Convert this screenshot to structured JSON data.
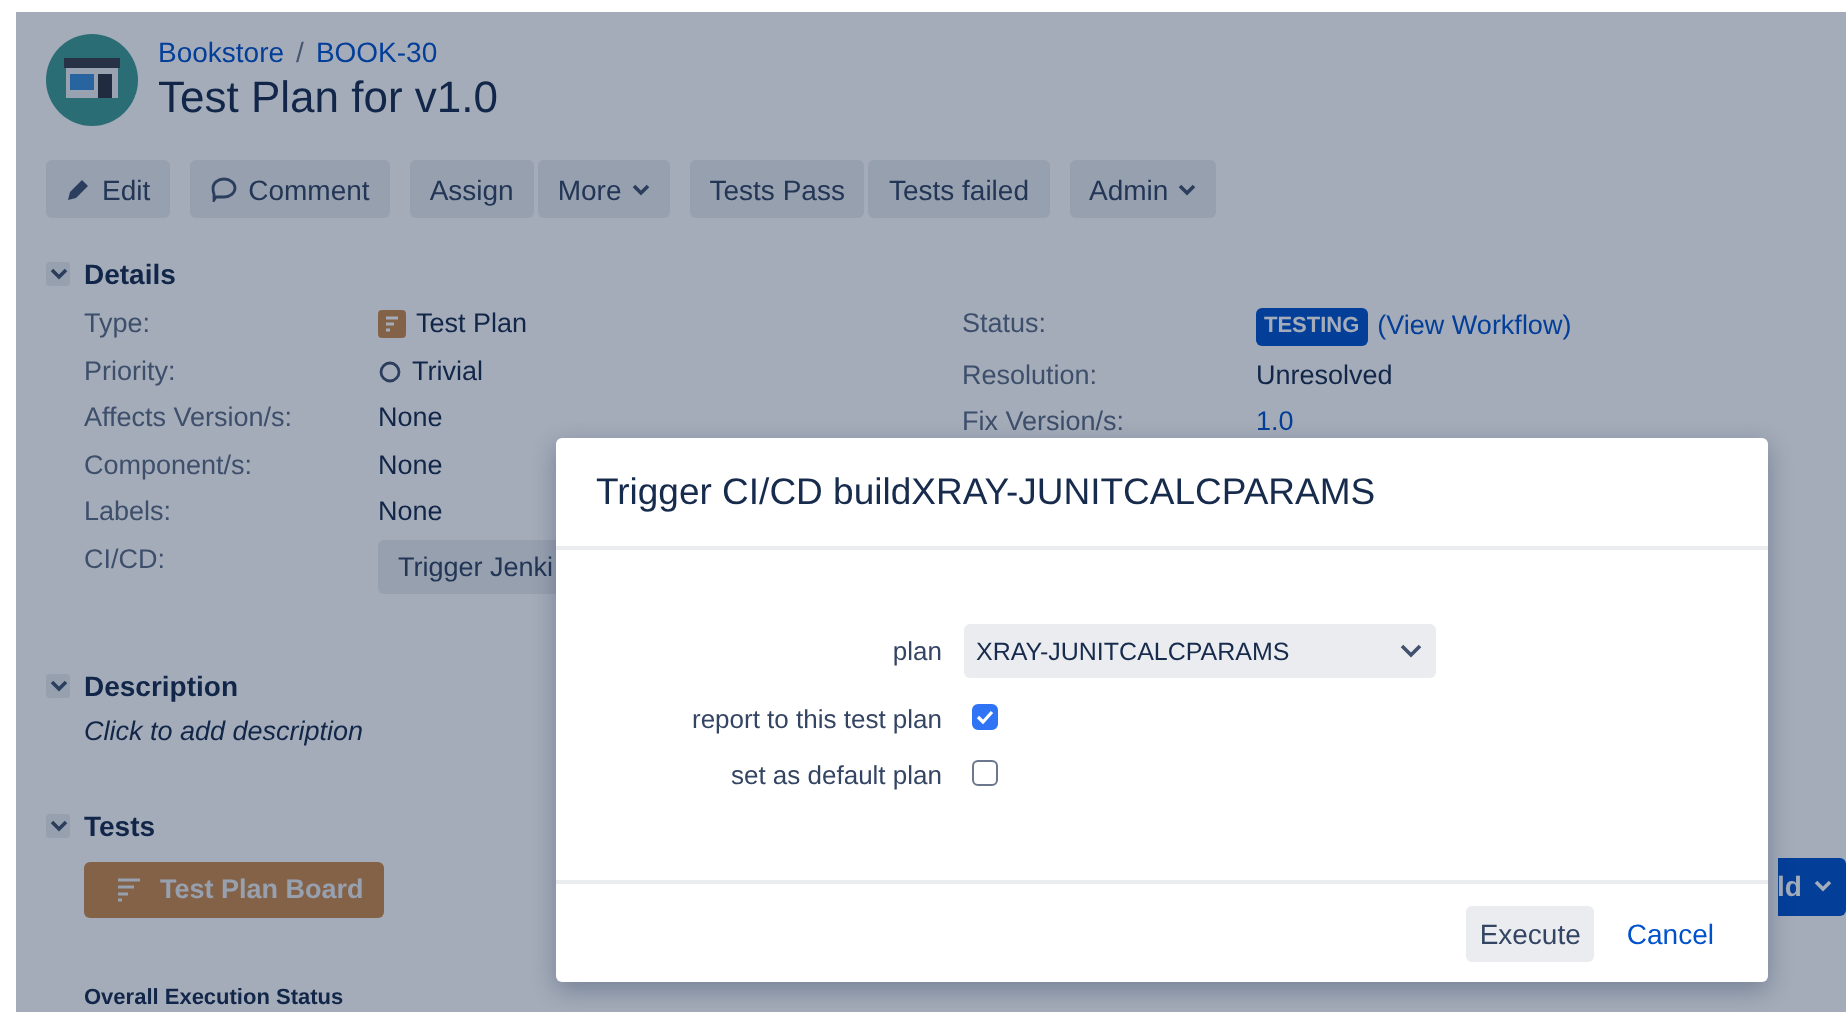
{
  "header": {
    "breadcrumbs": [
      "Bookstore",
      "BOOK-30"
    ],
    "separator": "/",
    "title": "Test Plan for v1.0"
  },
  "toolbar_groups": [
    [
      {
        "label": "Edit",
        "kind": "edit"
      }
    ],
    [
      {
        "label": "Comment",
        "kind": "comment"
      }
    ],
    [
      {
        "label": "Assign",
        "kind": "plain"
      },
      {
        "label": "More",
        "kind": "menu"
      }
    ],
    [
      {
        "label": "Tests Pass",
        "kind": "plain"
      },
      {
        "label": "Tests failed",
        "kind": "plain"
      }
    ],
    [
      {
        "label": "Admin",
        "kind": "menu"
      }
    ]
  ],
  "details": {
    "heading": "Details",
    "expanded": true,
    "left": [
      {
        "label": "Type:",
        "value": "Test Plan",
        "kind": "type"
      },
      {
        "label": "Priority:",
        "value": "Trivial",
        "kind": "priority"
      },
      {
        "label": "Affects Version/s:",
        "value": "None",
        "kind": "text"
      },
      {
        "label": "Component/s:",
        "value": "None",
        "kind": "text"
      },
      {
        "label": "Labels:",
        "value": "None",
        "kind": "text"
      },
      {
        "label": "CI/CD:",
        "value": "Trigger Jenki",
        "kind": "button"
      }
    ],
    "right": [
      {
        "label": "Status:",
        "value": "TESTING",
        "link": "(View Workflow)",
        "kind": "status"
      },
      {
        "label": "Resolution:",
        "value": "Unresolved",
        "kind": "text"
      },
      {
        "label": "Fix Version/s:",
        "value": "1.0",
        "kind": "link"
      }
    ]
  },
  "description": {
    "heading": "Description",
    "expanded": true,
    "hint": "Click to add description"
  },
  "tests": {
    "heading": "Tests",
    "expanded": true,
    "board_button": "Test Plan Board",
    "add_button": "ld",
    "subheading": "Overall Execution Status"
  },
  "dialog": {
    "title": "Trigger CI/CD buildXRAY-JUNITCALCPARAMS",
    "plan_label": "plan",
    "plan_value": "XRAY-JUNITCALCPARAMS",
    "options": [
      {
        "label": "report to this test plan",
        "checked": true
      },
      {
        "label": "set as default plan",
        "checked": false
      }
    ],
    "buttons": [
      {
        "label": "Execute",
        "kind": "secondary"
      },
      {
        "label": "Cancel",
        "kind": "link"
      }
    ]
  }
}
